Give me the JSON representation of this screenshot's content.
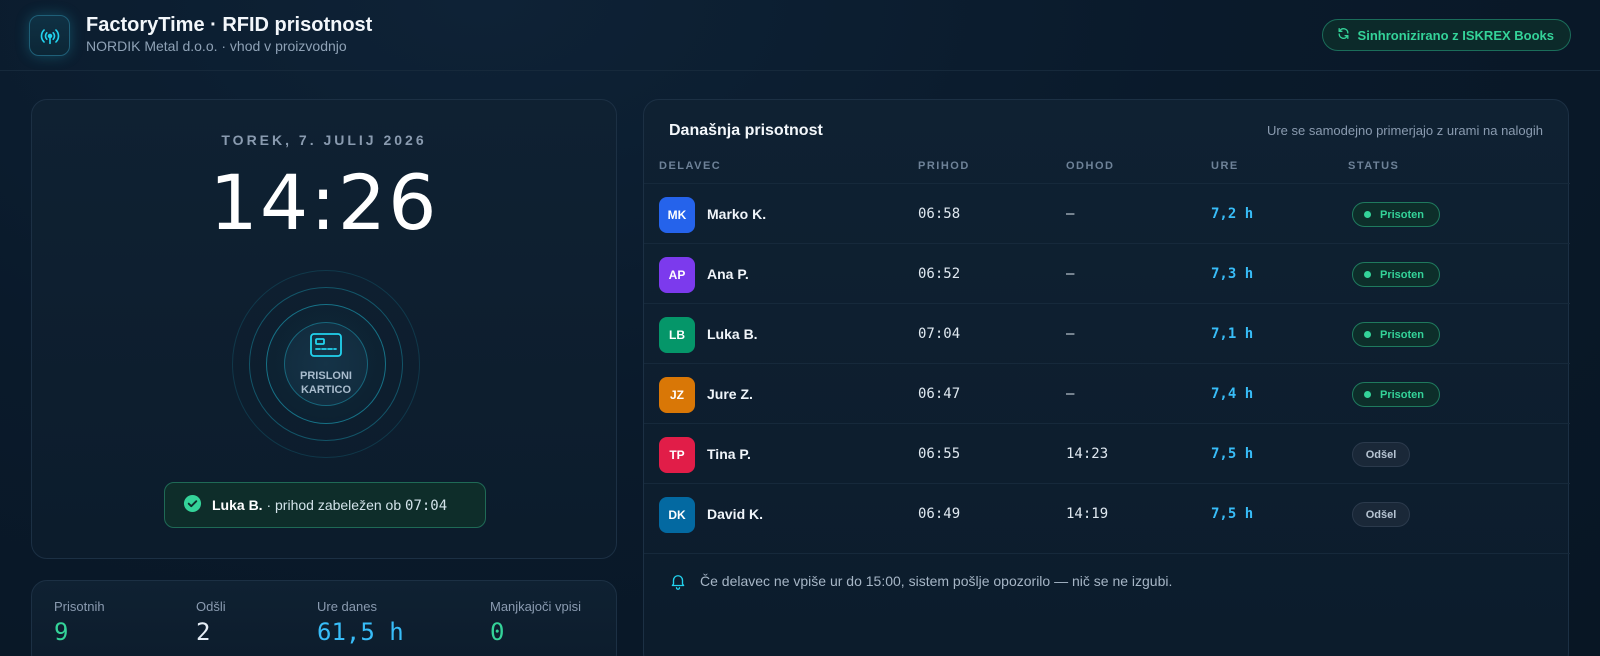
{
  "header": {
    "title": "FactoryTime · RFID prisotnost",
    "subtitle": "NORDIK Metal d.o.o. · vhod v proizvodnjo",
    "sync_label": "Sinhronizirano z ISKREX Books"
  },
  "terminal": {
    "date": "TOREK, 7. JULIJ 2026",
    "time": "14:26",
    "rfid_label": "PRISLONI KARTICO",
    "toast": {
      "name": "Luka B.",
      "message": " · prihod zabeležen ob ",
      "time": "07:04"
    }
  },
  "stats": [
    {
      "label": "Prisotnih",
      "value": "9",
      "color": "#34d399"
    },
    {
      "label": "Odšli",
      "value": "2",
      "color": "#e6eef6"
    },
    {
      "label": "Ure danes",
      "value": "61,5 h",
      "color": "#38bdf8"
    },
    {
      "label": "Manjkajoči vpisi",
      "value": "0",
      "color": "#34d399"
    }
  ],
  "attendance": {
    "title": "Današnja prisotnost",
    "note": "Ure se samodejno primerjajo z urami na nalogih",
    "columns": [
      "DELAVEC",
      "PRIHOD",
      "ODHOD",
      "URE",
      "STATUS"
    ],
    "rows": [
      {
        "initials": "MK",
        "name": "Marko K.",
        "in": "06:58",
        "out": "—",
        "hours": "7,2 h",
        "status": "Prisoten",
        "state": "present",
        "color": "#2563eb"
      },
      {
        "initials": "AP",
        "name": "Ana P.",
        "in": "06:52",
        "out": "—",
        "hours": "7,3 h",
        "status": "Prisoten",
        "state": "present",
        "color": "#7c3aed"
      },
      {
        "initials": "LB",
        "name": "Luka B.",
        "in": "07:04",
        "out": "—",
        "hours": "7,1 h",
        "status": "Prisoten",
        "state": "present",
        "color": "#059669"
      },
      {
        "initials": "JZ",
        "name": "Jure Z.",
        "in": "06:47",
        "out": "—",
        "hours": "7,4 h",
        "status": "Prisoten",
        "state": "present",
        "color": "#d97706"
      },
      {
        "initials": "TP",
        "name": "Tina P.",
        "in": "06:55",
        "out": "14:23",
        "hours": "7,5 h",
        "status": "Odšel",
        "state": "left",
        "color": "#e11d48"
      },
      {
        "initials": "DK",
        "name": "David K.",
        "in": "06:49",
        "out": "14:19",
        "hours": "7,5 h",
        "status": "Odšel",
        "state": "left",
        "color": "#0369a1"
      }
    ],
    "footer": "Če delavec ne vpiše ur do 15:00, sistem pošlje opozorilo — nič se ne izgubi."
  },
  "icons": {
    "logo": "rfid-signal-icon",
    "sync": "refresh-icon",
    "card": "id-card-icon",
    "check": "check-circle-icon",
    "bell": "bell-icon"
  }
}
